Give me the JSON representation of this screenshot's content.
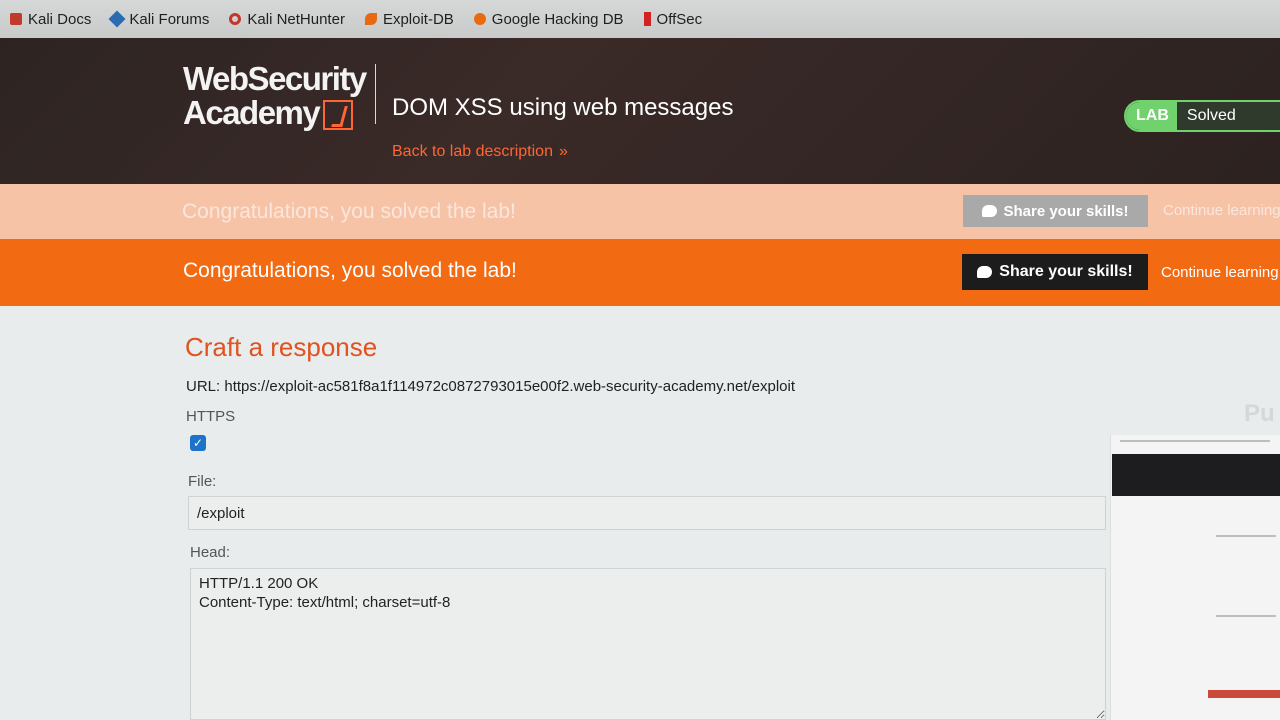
{
  "bookmarks": [
    {
      "label": "Kali Docs",
      "icon": "kali-icon"
    },
    {
      "label": "Kali Forums",
      "icon": "forum-icon"
    },
    {
      "label": "Kali NetHunter",
      "icon": "nethunter-icon"
    },
    {
      "label": "Exploit-DB",
      "icon": "exploit-db-icon"
    },
    {
      "label": "Google Hacking DB",
      "icon": "ghdb-icon"
    },
    {
      "label": "OffSec",
      "icon": "offsec-icon"
    }
  ],
  "header": {
    "logo_line1": "WebSecurity",
    "logo_line2": "Academy",
    "lab_title": "DOM XSS using web messages",
    "back_link": "Back to lab description",
    "status_tag": "LAB",
    "status_value": "Solved"
  },
  "notification": {
    "message": "Congratulations, you solved the lab!",
    "share_label": "Share your skills!",
    "continue_label": "Continue learning"
  },
  "form": {
    "title": "Craft a response",
    "url_label": "URL:",
    "url_value": "https://exploit-ac581f8a1f114972c0872793015e00f2.web-security-academy.net/exploit",
    "https_label": "HTTPS",
    "https_checked": true,
    "file_label": "File:",
    "file_value": "/exploit",
    "head_label": "Head:",
    "head_value": "HTTP/1.1 200 OK\nContent-Type: text/html; charset=utf-8"
  },
  "preview": {
    "title": "Pu"
  },
  "colors": {
    "accent": "#ff6633",
    "notification": "#f26a11",
    "status": "#70d16d",
    "header_bg": "#2d2422"
  }
}
